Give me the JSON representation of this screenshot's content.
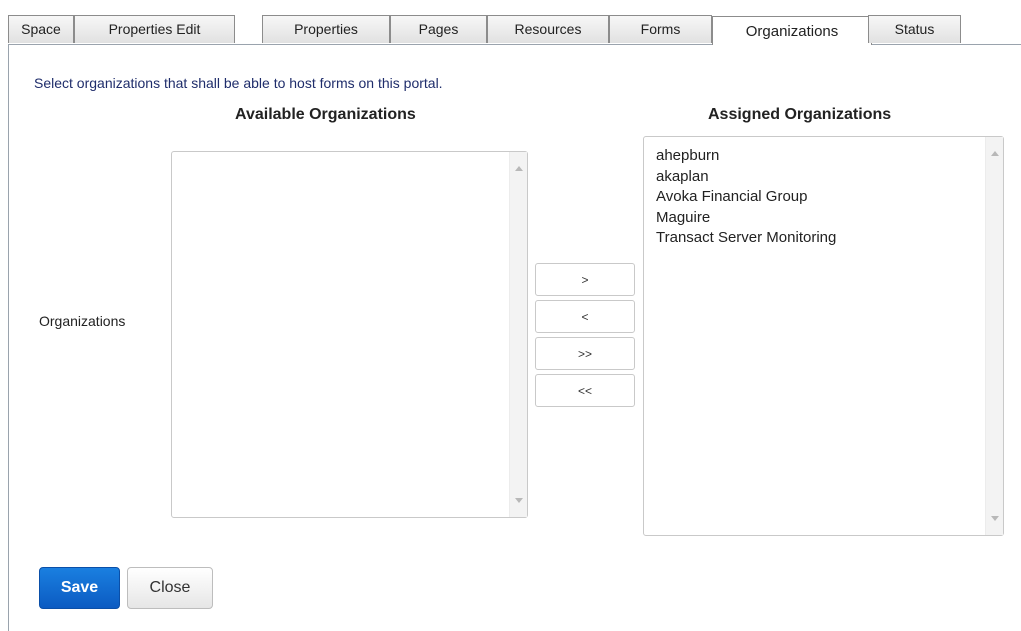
{
  "tabs": [
    {
      "label": "Space",
      "active": false
    },
    {
      "label": "Properties Edit",
      "active": false
    },
    {
      "label": "Properties",
      "active": false
    },
    {
      "label": "Pages",
      "active": false
    },
    {
      "label": "Resources",
      "active": false
    },
    {
      "label": "Forms",
      "active": false
    },
    {
      "label": "Organizations",
      "active": true
    },
    {
      "label": "Status",
      "active": false
    }
  ],
  "instructions": "Select organizations that shall be able to host forms on this portal.",
  "field_label": "Organizations",
  "available": {
    "title": "Available Organizations",
    "items": []
  },
  "assigned": {
    "title": "Assigned Organizations",
    "items": [
      "ahepburn",
      "akaplan",
      "Avoka Financial Group",
      "Maguire",
      "Transact Server Monitoring"
    ]
  },
  "move_buttons": {
    "add": ">",
    "remove": "<",
    "add_all": ">>",
    "remove_all": "<<"
  },
  "actions": {
    "save": "Save",
    "close": "Close"
  },
  "colors": {
    "primary_button": "#0b5bc2",
    "instruction_text": "#1f2d6b"
  }
}
